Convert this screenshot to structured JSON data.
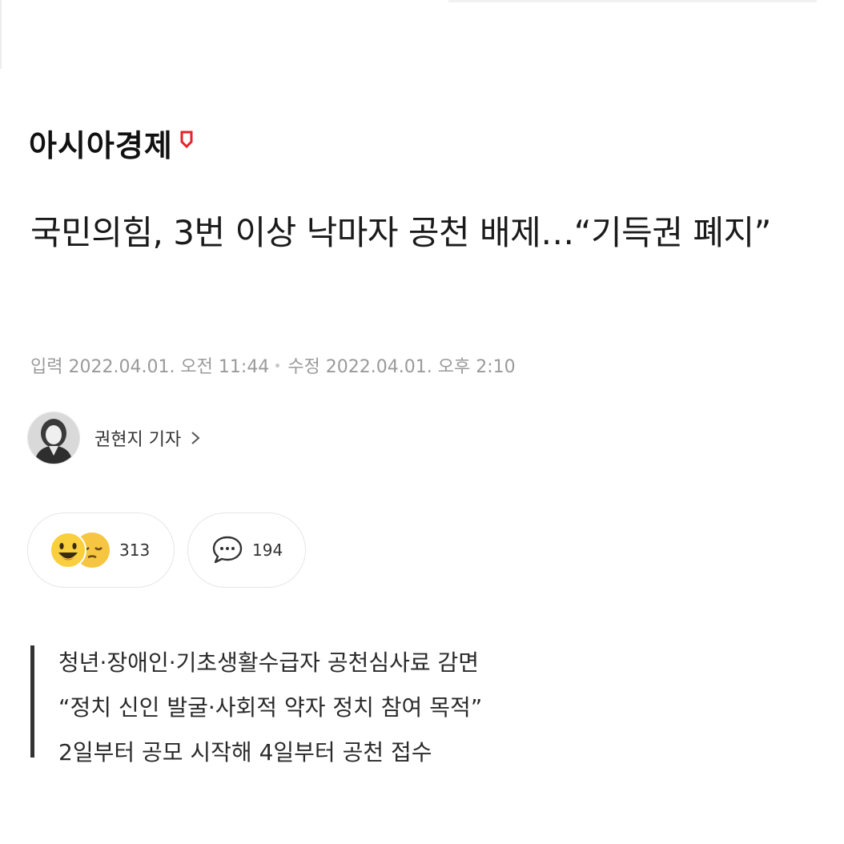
{
  "brand": {
    "name": "아시아경제",
    "accent_color": "#e5232a"
  },
  "article": {
    "headline": "국민의힘, 3번 이상 낙마자 공천 배제…“기득권 폐지”",
    "input_label": "입력",
    "input_time": "2022.04.01. 오전 11:44",
    "updated_label": "수정",
    "updated_time": "2022.04.01. 오후 2:10"
  },
  "reporter": {
    "name": "권현지 기자",
    "avatar_icon": "reporter-avatar"
  },
  "reactions": {
    "emoji_count": "313",
    "comment_count": "194",
    "emoji_icons": [
      "laughing-face-icon",
      "sleepy-face-icon"
    ],
    "comment_icon": "speech-bubble-icon"
  },
  "summary": {
    "lines": [
      "청년·장애인·기초생활수급자 공천심사료 감면",
      "“정치 신인 발굴·사회적 약자 정치 참여 목적”",
      "2일부터 공모 시작해 4일부터 공천 접수"
    ]
  }
}
